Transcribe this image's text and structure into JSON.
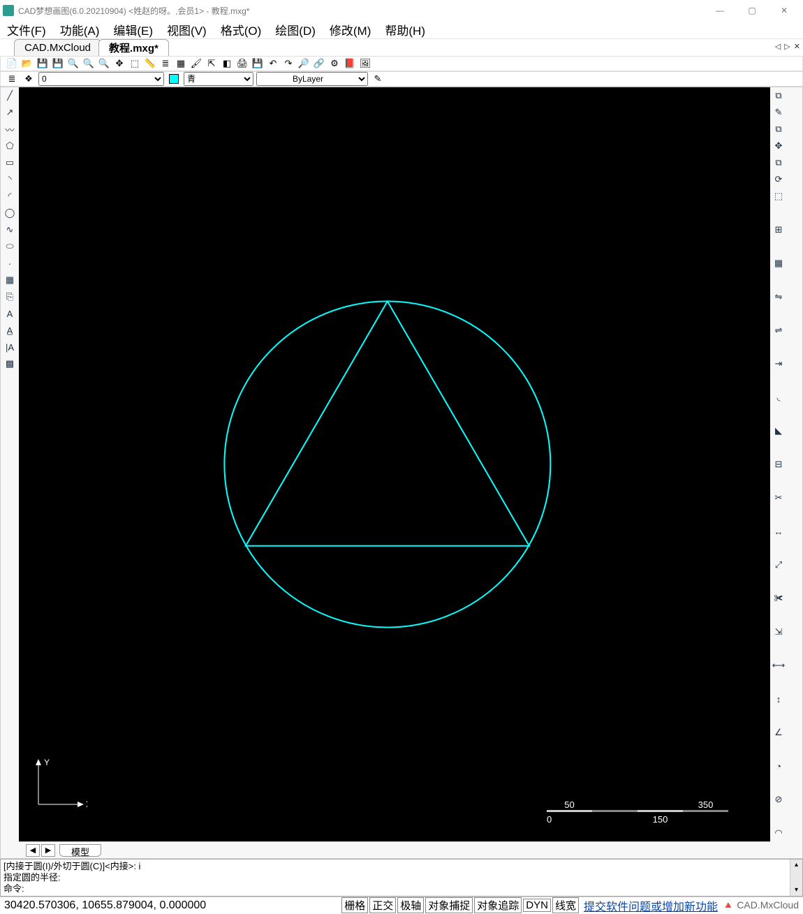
{
  "titlebar": {
    "title": "CAD梦想画图(6.0.20210904) <姓赵的呀。,会员1> - 教程.mxg*"
  },
  "menu": [
    {
      "label": "文件(F)"
    },
    {
      "label": "功能(A)"
    },
    {
      "label": "编辑(E)"
    },
    {
      "label": "视图(V)"
    },
    {
      "label": "格式(O)"
    },
    {
      "label": "绘图(D)"
    },
    {
      "label": "修改(M)"
    },
    {
      "label": "帮助(H)"
    }
  ],
  "tabs": [
    {
      "label": "CAD.MxCloud",
      "active": false
    },
    {
      "label": "教程.mxg*",
      "active": true
    }
  ],
  "layer": {
    "current": "0",
    "color_label": "青",
    "linetype": "ByLayer"
  },
  "left_tools": [
    "line",
    "poly",
    "polyline",
    "polygon",
    "rect",
    "arc",
    "arc2",
    "circle",
    "spline",
    "ellipse",
    "point",
    "hatch",
    "insert",
    "text-A",
    "mtext",
    "hatch-ia",
    "block"
  ],
  "right_tools": [
    "copy-b",
    "pencil",
    "copy",
    "move",
    "copy2",
    "rotate",
    "select",
    "grid",
    "array",
    "mirror",
    "mirror2",
    "offset",
    "fillet",
    "chamfer",
    "break",
    "hatch-r",
    "stretch",
    "scale",
    "trim",
    "extend",
    "dim-h",
    "dim-v",
    "dim-ang",
    "dim-r",
    "dim-d",
    "arc-d"
  ],
  "ruler": {
    "labels": [
      "0",
      "50",
      "150",
      "350"
    ]
  },
  "axis": {
    "x": "X",
    "y": "Y"
  },
  "model_tab": "模型",
  "cmd": {
    "line1": "[内接于圆(I)/外切于圆(C)]<内接>: i",
    "line2": "指定圆的半径:",
    "line3": "命令:"
  },
  "status": {
    "coords": "30420.570306, 10655.879004, 0.000000",
    "buttons": [
      "栅格",
      "正交",
      "极轴",
      "对象捕捉",
      "对象追踪",
      "DYN",
      "线宽"
    ],
    "link": "提交软件问题或增加新功能",
    "cloud": "CAD.MxCloud"
  }
}
